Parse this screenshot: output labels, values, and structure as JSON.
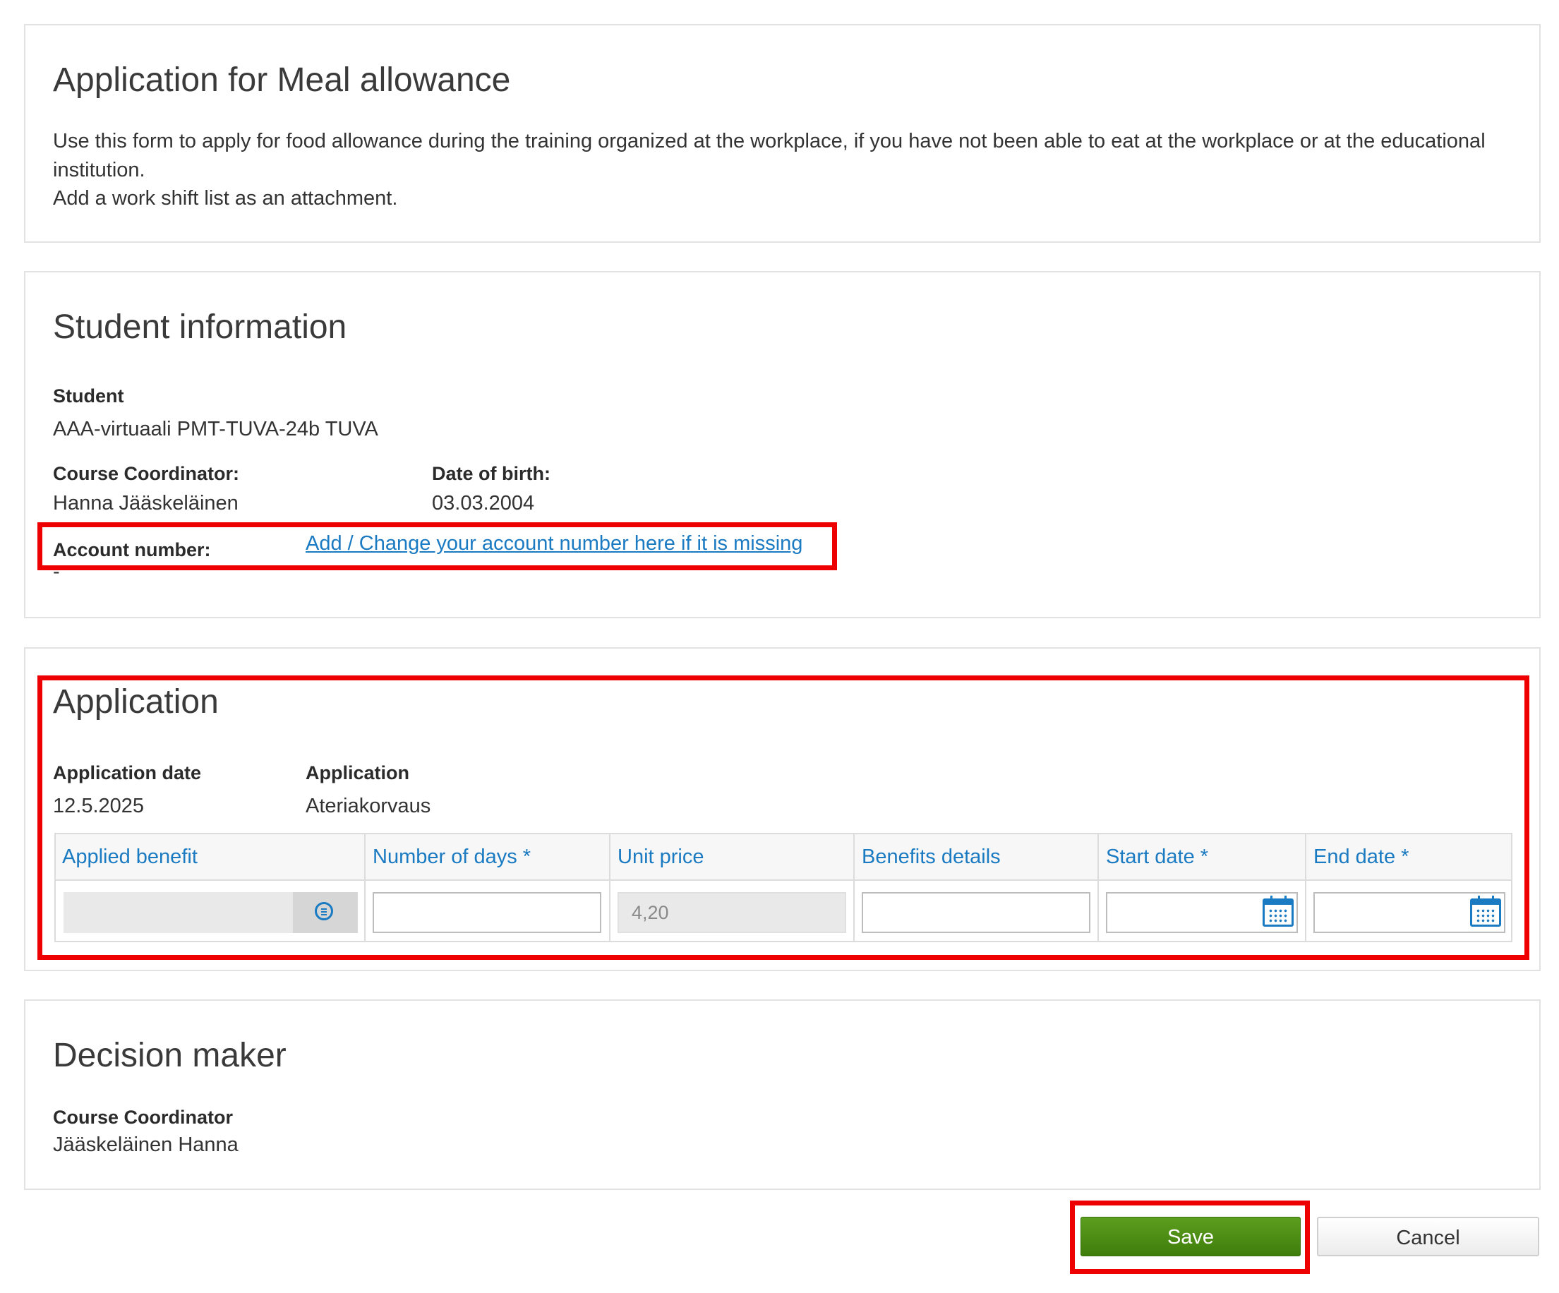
{
  "intro": {
    "title": "Application for Meal allowance",
    "line1": "Use this form to apply for food allowance during the training organized at the workplace, if you have not been able to eat at the workplace or at the educational",
    "line2": "institution.",
    "line3": "Add a work shift list as an attachment."
  },
  "student_info": {
    "title": "Student information",
    "student_label": "Student",
    "student_value": "AAA-virtuaali PMT-TUVA-24b TUVA",
    "coordinator_label": "Course Coordinator:",
    "coordinator_value": "Hanna Jääskeläinen",
    "dob_label": "Date of birth:",
    "dob_value": "03.03.2004",
    "account_label": "Account number:",
    "account_link": "Add / Change your account number here if it is missing",
    "account_value": "-"
  },
  "application": {
    "title": "Application",
    "date_label": "Application date",
    "date_value": "12.5.2025",
    "type_label": "Application",
    "type_value": "Ateriakorvaus",
    "columns": [
      "Applied benefit",
      "Number of days *",
      "Unit price",
      "Benefits details",
      "Start date *",
      "End date *"
    ],
    "row": {
      "applied_benefit": "",
      "number_of_days": "",
      "unit_price": "4,20",
      "benefits_details": "",
      "start_date": "",
      "end_date": ""
    }
  },
  "decision": {
    "title": "Decision maker",
    "role_label": "Course Coordinator",
    "name_value": "Jääskeläinen Hanna"
  },
  "buttons": {
    "save": "Save",
    "cancel": "Cancel"
  },
  "colors": {
    "accent": "#1a7ac2",
    "save_green": "#4a8b12",
    "highlight_red": "#ee0000"
  },
  "icons": {
    "select": "list-select-icon",
    "calendar": "calendar-icon"
  }
}
